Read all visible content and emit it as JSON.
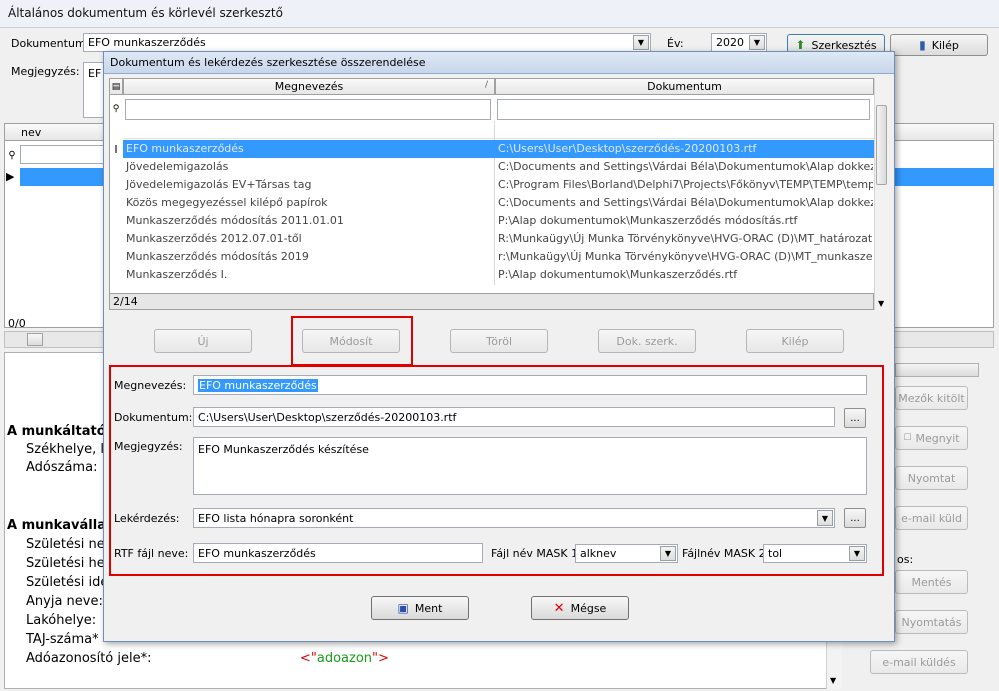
{
  "window": {
    "title": "Általános dokumentum és körlevél szerkesztő"
  },
  "topbar": {
    "dokumentum_label": "Dokumentum:",
    "dokumentum_value": "EFO munkaszerződés",
    "ev_label": "Év:",
    "ev_value": "2020",
    "szerkesztes_label": "Szerkesztés",
    "kilep_label": "Kilép",
    "megjegyzes_label": "Megjegyzés:",
    "megjegyzes_value": "EF"
  },
  "left_grid": {
    "header": "nev",
    "status": "0/0"
  },
  "doc_preview": {
    "munkaltato": "A munkáltató",
    "szekhelye": "Székhelye, la",
    "adoszama": "Adószáma:",
    "munkavallalo": "A munkavállal",
    "szul_ne": "Születési ne",
    "szul_he": "Születési he",
    "szul_ide": "Születési ide",
    "anyja": "Anyja neve:",
    "lakohely": "Lakóhelye:",
    "taj": "TAJ-száma*",
    "adoazon_label": "Adóazonosító jele*:",
    "adoazon_field": "<\"adoazon\">"
  },
  "side_buttons": {
    "mezok": "Mezők kitölt",
    "megnyit": "Megnyit",
    "nyomtat": "Nyomtat",
    "email": "e-mail küld",
    "os_label": "os:",
    "mentes": "Mentés",
    "nyomtatas": "Nyomtatás",
    "email_kuldes": "e-mail küldés"
  },
  "dialog": {
    "title": "Dokumentum és lekérdezés szerkesztése összerendelése",
    "col_megnevezes": "Megnevezés",
    "col_dokumentum": "Dokumentum",
    "rows": [
      {
        "name": "EFO munkaszerződés",
        "doc": "C:\\Users\\User\\Desktop\\szerződés-20200103.rtf"
      },
      {
        "name": "Jövedelemigazolás",
        "doc": "C:\\Documents and Settings\\Várdai Béla\\Dokumentumok\\Alap dokkezelő\\Jö..."
      },
      {
        "name": "Jövedelemigazolás EV+Társas tag",
        "doc": "C:\\Program Files\\Borland\\Delphi7\\Projects\\Főkönyv\\TEMP\\TEMP\\temp.rtf"
      },
      {
        "name": "Közös megegyezéssel kilépő papírok",
        "doc": "C:\\Documents and Settings\\Várdai Béla\\Dokumentumok\\Alap dokkezelő\\M..."
      },
      {
        "name": "Munkaszerződés módosítás 2011.01.01",
        "doc": "P:\\Alap dokumentumok\\Munkaszerződés módosítás.rtf"
      },
      {
        "name": "Munkaszerződés 2012.07.01-től",
        "doc": "R:\\Munkaügy\\Új Munka Törvénykönyve\\HVG-ORAC (D)\\MT_határozatlan i..."
      },
      {
        "name": "Munkaszerződés módosítás 2019",
        "doc": "r:\\Munkaügy\\Új Munka Törvénykönyve\\HVG-ORAC (D)\\MT_munkaszerződ..."
      },
      {
        "name": "Munkaszerződés I.",
        "doc": "P:\\Alap dokumentumok\\Munkaszerződés.rtf"
      }
    ],
    "record_status": "2/14",
    "btn_uj": "Új",
    "btn_modosit": "Módosít",
    "btn_torol": "Töröl",
    "btn_dok": "Dok. szerk.",
    "btn_kilep": "Kilép",
    "megnevezes_label": "Megnevezés:",
    "megnevezes_value": "EFO munkaszerződés",
    "dokumentum_label": "Dokumentum:",
    "dokumentum_value": "C:\\Users\\User\\Desktop\\szerződés-20200103.rtf",
    "megjegyzes_label": "Megjegyzés:",
    "megjegyzes_value": "EFO Munkaszerződés készítése",
    "lekerdezes_label": "Lekérdezés:",
    "lekerdezes_value": "EFO lista hónapra soronként",
    "rtf_label": "RTF fájl neve:",
    "rtf_value": "EFO munkaszerződés",
    "mask1_label": "Fájl név MASK 1:",
    "mask1_value": "alknev",
    "mask2_label": "Fájlnév MASK 2:",
    "mask2_value": "tol",
    "btn_ment": "Ment",
    "btn_megse": "Mégse",
    "ellipsis": "..."
  },
  "colors": {
    "selection": "#3399ff",
    "highlight_red": "#e00000",
    "title_gradient": "#c7d6ea"
  }
}
